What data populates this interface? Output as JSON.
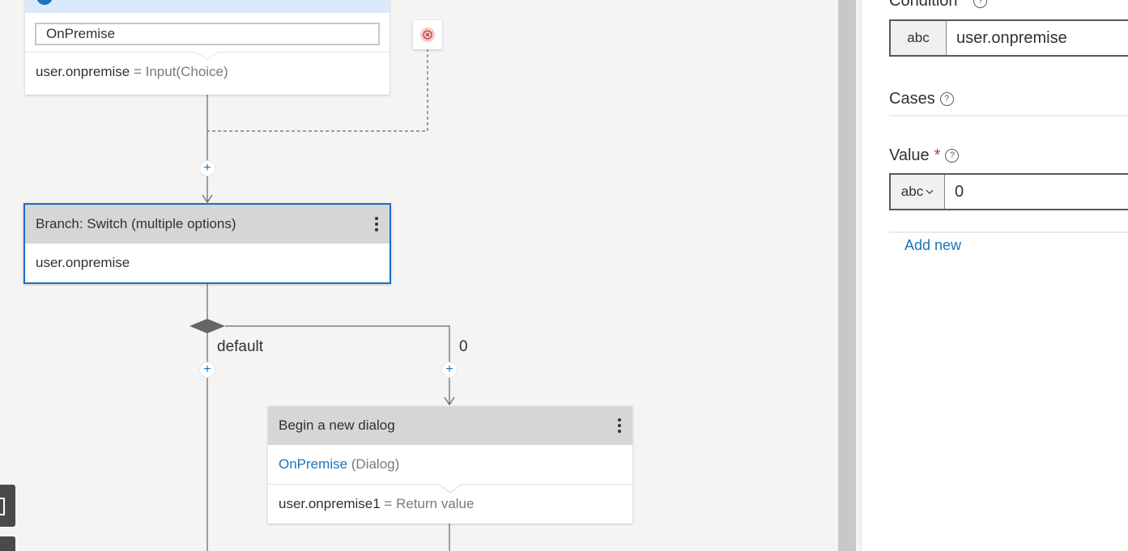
{
  "prompt_card": {
    "input_value": "OnPremise",
    "property": "user.onpremise",
    "assignment": "= Input(Choice)"
  },
  "switch_card": {
    "title": "Branch: Switch (multiple options)",
    "condition": "user.onpremise"
  },
  "branches": {
    "default_label": "default",
    "case_label": "0"
  },
  "dialog_card": {
    "title": "Begin a new dialog",
    "dialog_name": "OnPremise",
    "dialog_suffix": "(Dialog)",
    "property": "user.onpremise1",
    "assignment": "= Return value"
  },
  "panel": {
    "condition_label": "Condition",
    "condition_type": "abc",
    "condition_value": "user.onpremise",
    "cases_label": "Cases",
    "value_label": "Value",
    "value_type": "abc",
    "value_value": "0",
    "add_new": "Add new"
  },
  "colors": {
    "accent": "#1b74b8",
    "selected_border": "#1b6ec2",
    "header_gray": "#d6d6d6",
    "required": "#c4314b"
  },
  "icons": [
    "close-circle-icon",
    "plus-icon",
    "kebab-menu-icon",
    "help-icon",
    "chevron-down-icon"
  ]
}
